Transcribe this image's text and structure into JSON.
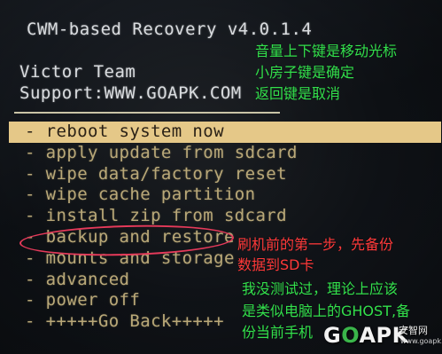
{
  "header": {
    "title": "CWM-based Recovery v4.0.1.4",
    "team": "Victor Team",
    "support": "Support:WWW.GOAPK.COM"
  },
  "menu": {
    "items": [
      {
        "label": "- reboot system now",
        "selected": true
      },
      {
        "label": "- apply update from sdcard",
        "selected": false
      },
      {
        "label": "- wipe data/factory reset",
        "selected": false
      },
      {
        "label": "- wipe cache partition",
        "selected": false
      },
      {
        "label": "- install zip from sdcard",
        "selected": false
      },
      {
        "label": "- backup and restore",
        "selected": false
      },
      {
        "label": "- mounts and storage",
        "selected": false
      },
      {
        "label": "- advanced",
        "selected": false
      },
      {
        "label": "- power off",
        "selected": false
      },
      {
        "label": "- +++++Go Back+++++",
        "selected": false
      }
    ]
  },
  "annotations": {
    "keys_line1": "音量上下键是移动光标",
    "keys_line2": "小房子键是确定",
    "keys_line3": "返回键是取消",
    "backup_line1": "刷机前的第一步，先备份",
    "backup_line2": "数据到SD卡",
    "note_line1": "我没测试过，理论上应该",
    "note_line2": "是类似电脑上的GHOST,备",
    "note_line3": "份当前手机"
  },
  "watermark": {
    "brand_g": "G",
    "brand_o": "O",
    "brand_rest": "APK",
    "site_name": "安智网",
    "url": "www.goapk.com"
  },
  "colors": {
    "selected_bg": "#e5c888",
    "menu_text": "#b9a878",
    "annotation_green": "#33e04c",
    "annotation_red": "#ff3a3a"
  }
}
